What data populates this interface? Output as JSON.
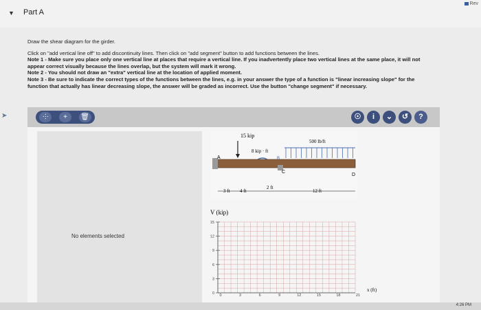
{
  "header": {
    "toggle_icon": "triangle-down-icon",
    "part_title": "Part A",
    "review_label": "Rev"
  },
  "instructions": {
    "line1": "Draw the shear diagram for the girder.",
    "line2": "Click on \"add vertical line off\" to add discontinuity lines. Then click on \"add segment\" button to add functions between the lines.",
    "line3": "Note 1 - Make sure you place only one vertical line at places that require a vertical line. If you inadvertently place two vertical lines at the same place, it will not",
    "line4": "appear correct visually because the lines overlap, but the system will mark it wrong.",
    "line5": "Note 2 - You should not draw an \"extra\" vertical line at the location of applied moment.",
    "line6": "Note 3 - Be sure to indicate the correct types of the functions between the lines, e.g. in your answer the type of a function is \"linear increasing slope\" for the",
    "line7": "function that actually has linear decreasing slope, the answer will be graded as incorrect. Use the button \"change segment\" if necessary."
  },
  "toolbar": {
    "left_buttons": [
      {
        "icon": "add-vertical-line-icon",
        "glyph": "⸭"
      },
      {
        "icon": "add-segment-icon",
        "glyph": "+"
      },
      {
        "icon": "delete-icon",
        "glyph": "🗑"
      }
    ],
    "right_buttons": [
      {
        "icon": "hint-icon",
        "glyph": "☉"
      },
      {
        "icon": "info-icon",
        "glyph": "i"
      },
      {
        "icon": "chevron-down-icon",
        "glyph": "⌄"
      },
      {
        "icon": "reset-icon",
        "glyph": "↺"
      },
      {
        "icon": "help-icon",
        "glyph": "?"
      }
    ]
  },
  "left_pane": {
    "status": "No elements selected"
  },
  "beam": {
    "point_load": "15 kip",
    "moment": "8 kip · ft",
    "distributed_load": "500 lb/ft",
    "points": [
      "A",
      "B",
      "C",
      "D"
    ],
    "dims": [
      "3 ft",
      "4 ft",
      "2 ft",
      "12 ft"
    ]
  },
  "chart_data": {
    "type": "line",
    "title": "",
    "ylabel": "V (kip)",
    "xlabel": "x (ft)",
    "xlim": [
      0,
      21
    ],
    "ylim": [
      0,
      15
    ],
    "x_ticks": [
      0,
      3,
      6,
      9,
      12,
      15,
      18,
      21
    ],
    "y_ticks": [
      0,
      3,
      6,
      9,
      12,
      15
    ],
    "grid": true,
    "series": []
  },
  "status_bar": {
    "time": "4:26 PM"
  },
  "colors": {
    "toolbar_blue": "#3c4f7d",
    "grid_red": "#d9a0a0",
    "beam_brown": "#8b5e3c",
    "load_blue": "#4a6fb0"
  }
}
